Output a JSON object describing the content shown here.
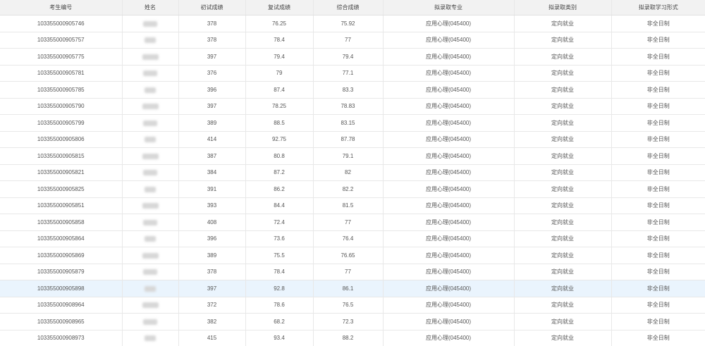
{
  "table": {
    "columns": [
      "考生编号",
      "姓名",
      "初试成绩",
      "复试成绩",
      "综合成绩",
      "拟录取专业",
      "拟录取类别",
      "拟录取学习形式"
    ],
    "highlight_row": 17,
    "rows": [
      {
        "id": "103355000905746",
        "initial": "378",
        "retest": "76.25",
        "total": "75.92",
        "major": "应用心理(045400)",
        "category": "定向就业",
        "mode": "非全日制"
      },
      {
        "id": "103355000905757",
        "initial": "378",
        "retest": "78.4",
        "total": "77",
        "major": "应用心理(045400)",
        "category": "定向就业",
        "mode": "非全日制"
      },
      {
        "id": "103355000905775",
        "initial": "397",
        "retest": "79.4",
        "total": "79.4",
        "major": "应用心理(045400)",
        "category": "定向就业",
        "mode": "非全日制"
      },
      {
        "id": "103355000905781",
        "initial": "376",
        "retest": "79",
        "total": "77.1",
        "major": "应用心理(045400)",
        "category": "定向就业",
        "mode": "非全日制"
      },
      {
        "id": "103355000905785",
        "initial": "396",
        "retest": "87.4",
        "total": "83.3",
        "major": "应用心理(045400)",
        "category": "定向就业",
        "mode": "非全日制"
      },
      {
        "id": "103355000905790",
        "initial": "397",
        "retest": "78.25",
        "total": "78.83",
        "major": "应用心理(045400)",
        "category": "定向就业",
        "mode": "非全日制"
      },
      {
        "id": "103355000905799",
        "initial": "389",
        "retest": "88.5",
        "total": "83.15",
        "major": "应用心理(045400)",
        "category": "定向就业",
        "mode": "非全日制"
      },
      {
        "id": "103355000905806",
        "initial": "414",
        "retest": "92.75",
        "total": "87.78",
        "major": "应用心理(045400)",
        "category": "定向就业",
        "mode": "非全日制"
      },
      {
        "id": "103355000905815",
        "initial": "387",
        "retest": "80.8",
        "total": "79.1",
        "major": "应用心理(045400)",
        "category": "定向就业",
        "mode": "非全日制"
      },
      {
        "id": "103355000905821",
        "initial": "384",
        "retest": "87.2",
        "total": "82",
        "major": "应用心理(045400)",
        "category": "定向就业",
        "mode": "非全日制"
      },
      {
        "id": "103355000905825",
        "initial": "391",
        "retest": "86.2",
        "total": "82.2",
        "major": "应用心理(045400)",
        "category": "定向就业",
        "mode": "非全日制"
      },
      {
        "id": "103355000905851",
        "initial": "393",
        "retest": "84.4",
        "total": "81.5",
        "major": "应用心理(045400)",
        "category": "定向就业",
        "mode": "非全日制"
      },
      {
        "id": "103355000905858",
        "initial": "408",
        "retest": "72.4",
        "total": "77",
        "major": "应用心理(045400)",
        "category": "定向就业",
        "mode": "非全日制"
      },
      {
        "id": "103355000905864",
        "initial": "396",
        "retest": "73.6",
        "total": "76.4",
        "major": "应用心理(045400)",
        "category": "定向就业",
        "mode": "非全日制"
      },
      {
        "id": "103355000905869",
        "initial": "389",
        "retest": "75.5",
        "total": "76.65",
        "major": "应用心理(045400)",
        "category": "定向就业",
        "mode": "非全日制"
      },
      {
        "id": "103355000905879",
        "initial": "378",
        "retest": "78.4",
        "total": "77",
        "major": "应用心理(045400)",
        "category": "定向就业",
        "mode": "非全日制"
      },
      {
        "id": "103355000905898",
        "initial": "397",
        "retest": "92.8",
        "total": "86.1",
        "major": "应用心理(045400)",
        "category": "定向就业",
        "mode": "非全日制"
      },
      {
        "id": "103355000908964",
        "initial": "372",
        "retest": "78.6",
        "total": "76.5",
        "major": "应用心理(045400)",
        "category": "定向就业",
        "mode": "非全日制"
      },
      {
        "id": "103355000908965",
        "initial": "382",
        "retest": "68.2",
        "total": "72.3",
        "major": "应用心理(045400)",
        "category": "定向就业",
        "mode": "非全日制"
      },
      {
        "id": "103355000908973",
        "initial": "415",
        "retest": "93.4",
        "total": "88.2",
        "major": "应用心理(045400)",
        "category": "定向就业",
        "mode": "非全日制"
      }
    ]
  }
}
